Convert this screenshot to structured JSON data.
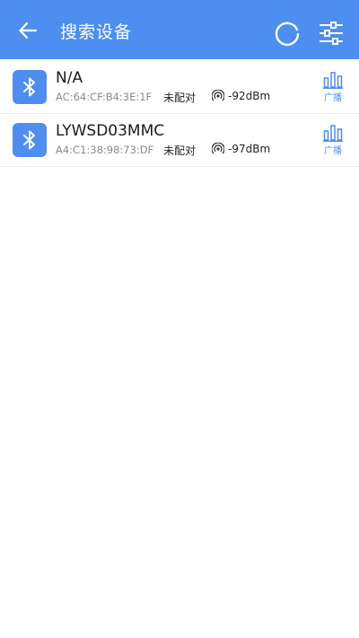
{
  "appbar": {
    "title": "搜索设备",
    "icons": {
      "back": "back-arrow-icon",
      "refresh": "refresh-icon",
      "filter": "filter-sliders-icon"
    }
  },
  "colors": {
    "primary": "#4d8ef0",
    "text": "#1a1a1a",
    "secondary_text": "#8a8a8a"
  },
  "devices": [
    {
      "name": "N/A",
      "mac": "AC:64:CF:B4:3E:1F",
      "pair_status": "未配对",
      "rssi": "-92dBm",
      "adv_label": "广播"
    },
    {
      "name": "LYWSD03MMC",
      "mac": "A4:C1:38:98:73:DF",
      "pair_status": "未配对",
      "rssi": "-97dBm",
      "adv_label": "广播"
    }
  ]
}
